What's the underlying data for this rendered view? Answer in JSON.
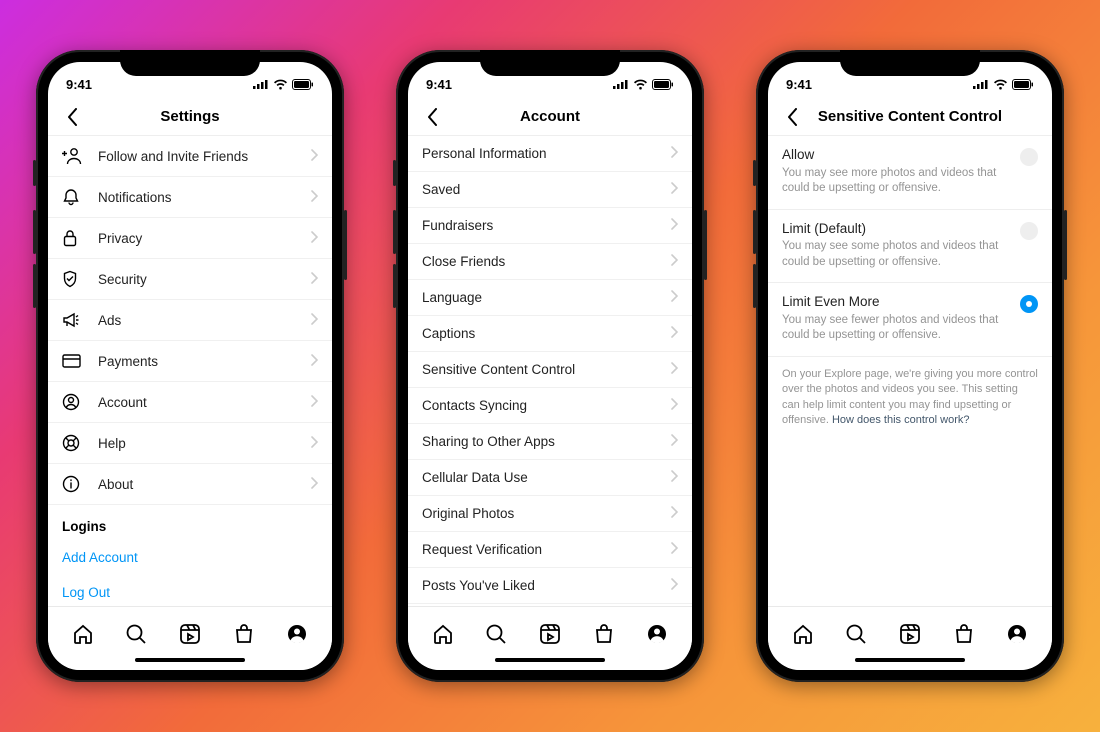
{
  "status_time": "9:41",
  "phone1": {
    "title": "Settings",
    "items": [
      {
        "label": "Follow and Invite Friends"
      },
      {
        "label": "Notifications"
      },
      {
        "label": "Privacy"
      },
      {
        "label": "Security"
      },
      {
        "label": "Ads"
      },
      {
        "label": "Payments"
      },
      {
        "label": "Account"
      },
      {
        "label": "Help"
      },
      {
        "label": "About"
      }
    ],
    "section": "Logins",
    "add_account": "Add Account",
    "log_out": "Log Out"
  },
  "phone2": {
    "title": "Account",
    "items": [
      {
        "label": "Personal Information"
      },
      {
        "label": "Saved"
      },
      {
        "label": "Fundraisers"
      },
      {
        "label": "Close Friends"
      },
      {
        "label": "Language"
      },
      {
        "label": "Captions"
      },
      {
        "label": "Sensitive Content Control"
      },
      {
        "label": "Contacts Syncing"
      },
      {
        "label": "Sharing to Other Apps"
      },
      {
        "label": "Cellular Data Use"
      },
      {
        "label": "Original Photos"
      },
      {
        "label": "Request Verification"
      },
      {
        "label": "Posts You've Liked"
      }
    ]
  },
  "phone3": {
    "title": "Sensitive Content Control",
    "opts": [
      {
        "title": "Allow",
        "sub": "You may see more photos and videos that could be upsetting or offensive."
      },
      {
        "title": "Limit (Default)",
        "sub": "You may see some photos and videos that could be upsetting or offensive."
      },
      {
        "title": "Limit Even More",
        "sub": "You may see fewer photos and videos that could be upsetting or offensive."
      }
    ],
    "explainer": "On your Explore page, we're giving you more control over the photos and videos you see. This setting can help limit content you may find upsetting or offensive.",
    "explainer_link": "How does this control work?"
  }
}
